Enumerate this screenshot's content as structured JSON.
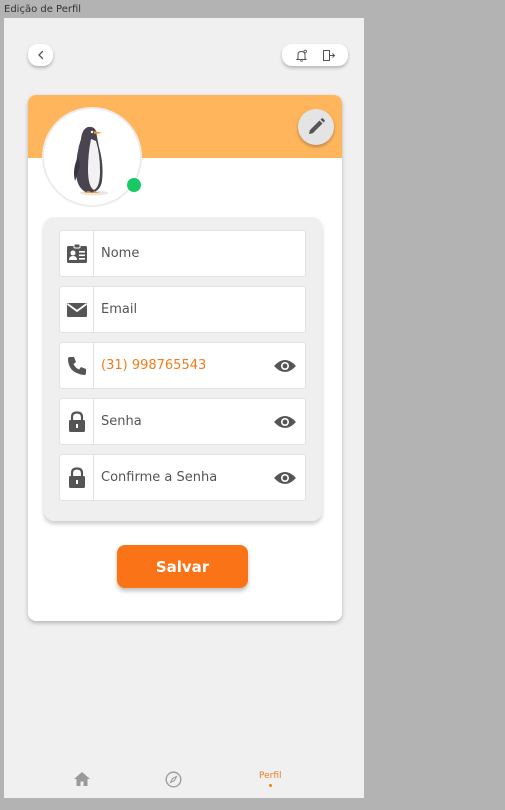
{
  "window": {
    "title": "Edição de Perfil"
  },
  "header": {
    "back_icon": "chevron-left-icon",
    "actions": [
      "bell-icon",
      "logout-icon"
    ]
  },
  "profile": {
    "banner_color": "#ffb55c",
    "avatar": "penguin-avatar",
    "status": "online",
    "status_color": "#17c964",
    "edit_icon": "pencil-icon"
  },
  "form": {
    "fields": [
      {
        "icon": "id-card-icon",
        "placeholder": "Nome",
        "has_eye": false
      },
      {
        "icon": "envelope-icon",
        "placeholder": "Email",
        "has_eye": false
      },
      {
        "icon": "phone-icon",
        "value": "(31) 998765543",
        "has_eye": true
      },
      {
        "icon": "lock-icon",
        "placeholder": "Senha",
        "has_eye": true
      },
      {
        "icon": "lock-icon",
        "placeholder": "Confirme a Senha",
        "has_eye": true
      }
    ],
    "save_label": "Salvar",
    "accent": "#fb7317"
  },
  "nav": {
    "items": [
      {
        "icon": "home-icon"
      },
      {
        "icon": "compass-icon"
      },
      {
        "label": "Perfil",
        "active": true
      }
    ]
  }
}
